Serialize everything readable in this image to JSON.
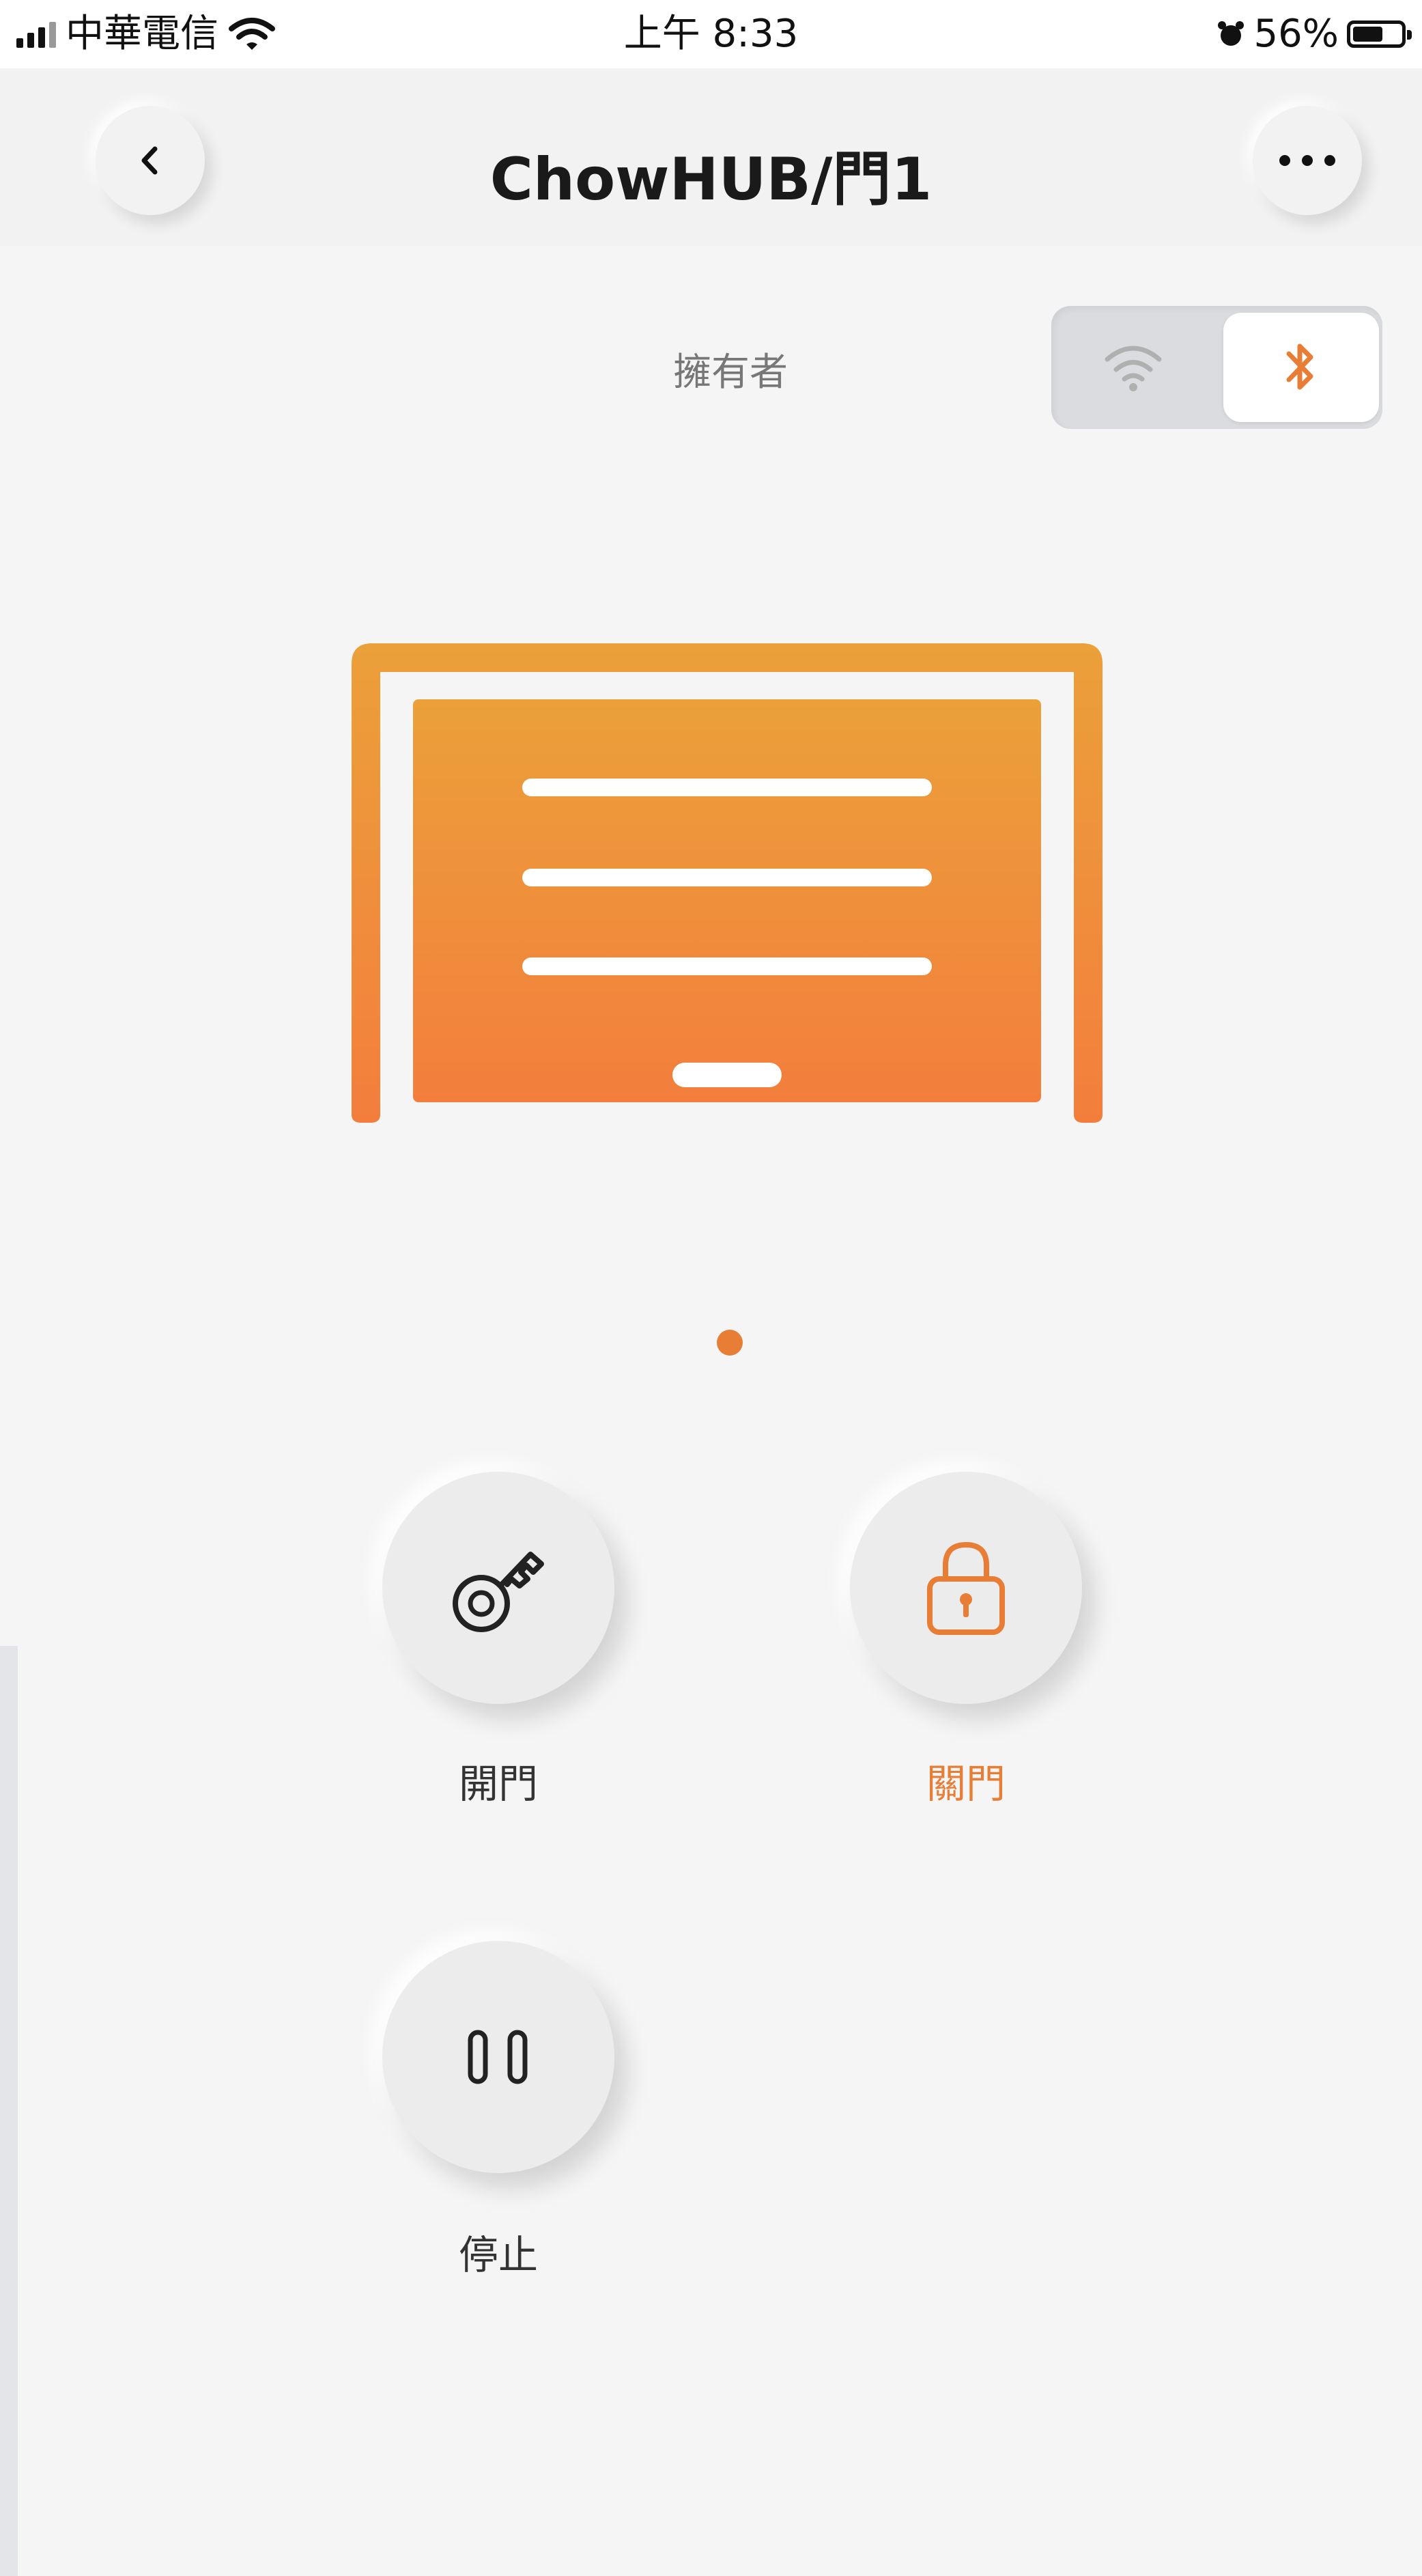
{
  "status_bar": {
    "carrier": "中華電信",
    "time": "上午 8:33",
    "battery": "56%",
    "battery_level": 0.56
  },
  "nav": {
    "title": "ChowHUB/門1",
    "back_icon": "chevron-left-icon",
    "more_icon": "more-horizontal-icon"
  },
  "owner_label": "擁有者",
  "connection": {
    "options": [
      "wifi",
      "bluetooth"
    ],
    "selected": "bluetooth"
  },
  "carousel": {
    "pages": 1,
    "current": 1
  },
  "actions": [
    {
      "label": "開門",
      "icon": "key-icon",
      "color": "#333333"
    },
    {
      "label": "關門",
      "icon": "lock-icon",
      "color": "#e87e35"
    },
    {
      "label": "停止",
      "icon": "pause-icon",
      "color": "#333333"
    }
  ],
  "colors": {
    "accent": "#e87e35",
    "door_top": "#eba03a",
    "door_bottom": "#f37e3c",
    "background": "#f5f5f5"
  }
}
